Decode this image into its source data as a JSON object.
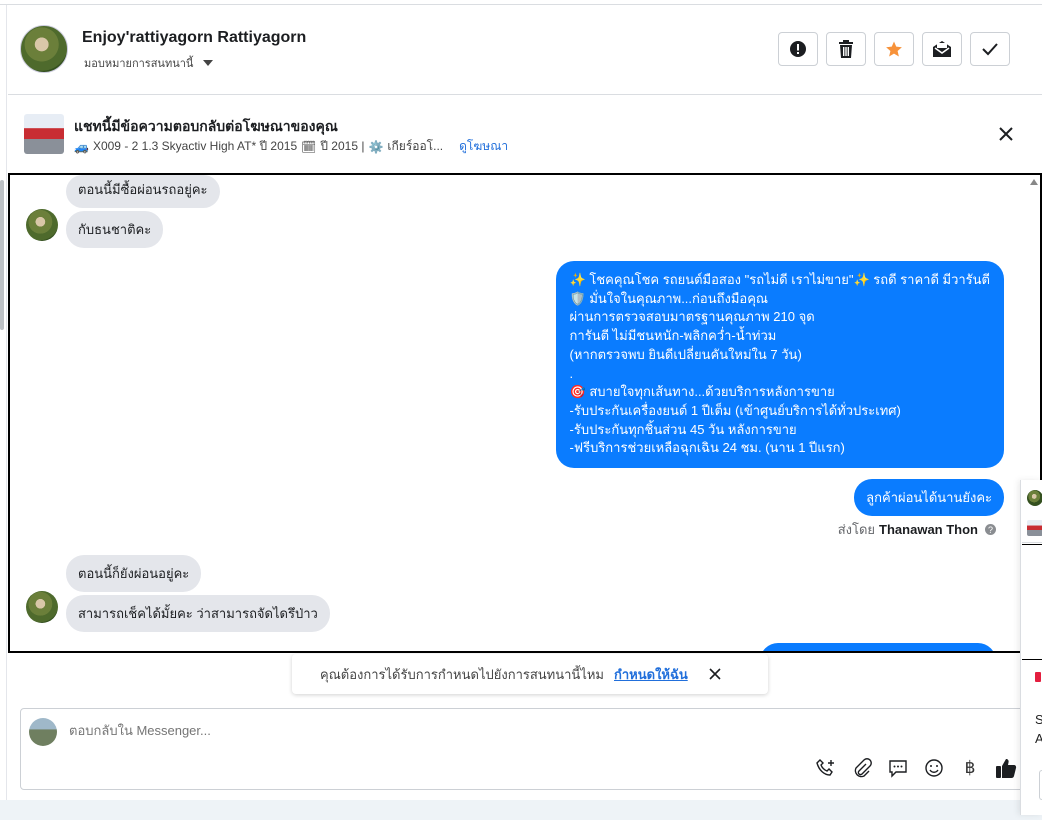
{
  "header": {
    "name": "Enjoy'rattiyagorn Rattiyagorn",
    "assign_label": "มอบหมายการสนทนานี้",
    "actions": [
      {
        "name": "report-icon"
      },
      {
        "name": "trash-icon"
      },
      {
        "name": "star-icon",
        "color": "#f7923a"
      },
      {
        "name": "mark-unread-icon"
      },
      {
        "name": "check-icon"
      }
    ]
  },
  "ad": {
    "title": "แชทนี้มีข้อความตอบกลับต่อโฆษณาของคุณ",
    "car_emoji": "🚙",
    "desc_model": "X009 - 2 1.3 Skyactiv High AT* ปี 2015",
    "calendar_emoji": "🗓",
    "desc_year": "ปี 2015 |",
    "gear_emoji": "⚙️",
    "desc_gear": "เกียร์ออโ...",
    "link": "ดูโฆษณา"
  },
  "messages": {
    "in1": "ตอนนี้มีซื้อผ่อนรถอยู่คะ",
    "in2": "กับธนชาติคะ",
    "out_long": [
      "✨ โชคคุณโชค รถยนต์มือสอง \"รถไม่ดี เราไม่ขาย\"✨ รถดี ราคาดี มีวารันตี",
      "🛡️ มั่นใจในคุณภาพ...ก่อนถึงมือคุณ",
      "ผ่านการตรวจสอบมาตรฐานคุณภาพ 210 จุด",
      "การันตี ไม่มีชนหนัก-พลิกคว่ำ-น้ำท่วม",
      "(หากตรวจพบ ยินดีเปลี่ยนคันใหม่ใน 7 วัน)",
      ".",
      "🎯 สบายใจทุกเส้นทาง...ด้วยบริการหลังการขาย",
      "-รับประกันเครื่องยนต์ 1 ปีเต็ม (เข้าศูนย์บริการได้ทั่วประเทศ)",
      "-รับประกันทุกชิ้นส่วน 45 วัน หลังการขาย",
      "-ฟรีบริการช่วยเหลือฉุกเฉิน 24 ชม. (นาน 1 ปีแรก)"
    ],
    "out2": "ลูกค้าผ่อนได้นานยังคะ",
    "sent_by_label": "ส่งโดย",
    "sent_by_name": "Thanawan Thon",
    "help_glyph": "?",
    "in3": "ตอนนี้ก็ยังผ่อนอยู่คะ",
    "in4": "สามารถเช็คได้มั้ยคะ ว่าสามารถจัดไดรึป่าว"
  },
  "reminder": {
    "text": "คุณต้องการได้รับการกำหนดไปยังการสนทนานี้ไหม",
    "link": "กำหนดให้ฉัน"
  },
  "composer": {
    "placeholder": "ตอบกลับใน Messenger...",
    "tools": [
      "phone-add-icon",
      "paperclip-icon",
      "saved-replies-icon",
      "emoji-icon",
      "baht-icon",
      "thumbs-up-icon"
    ],
    "baht_glyph": "฿"
  },
  "side_panel": {
    "letter1": "S",
    "letter2": "A"
  }
}
